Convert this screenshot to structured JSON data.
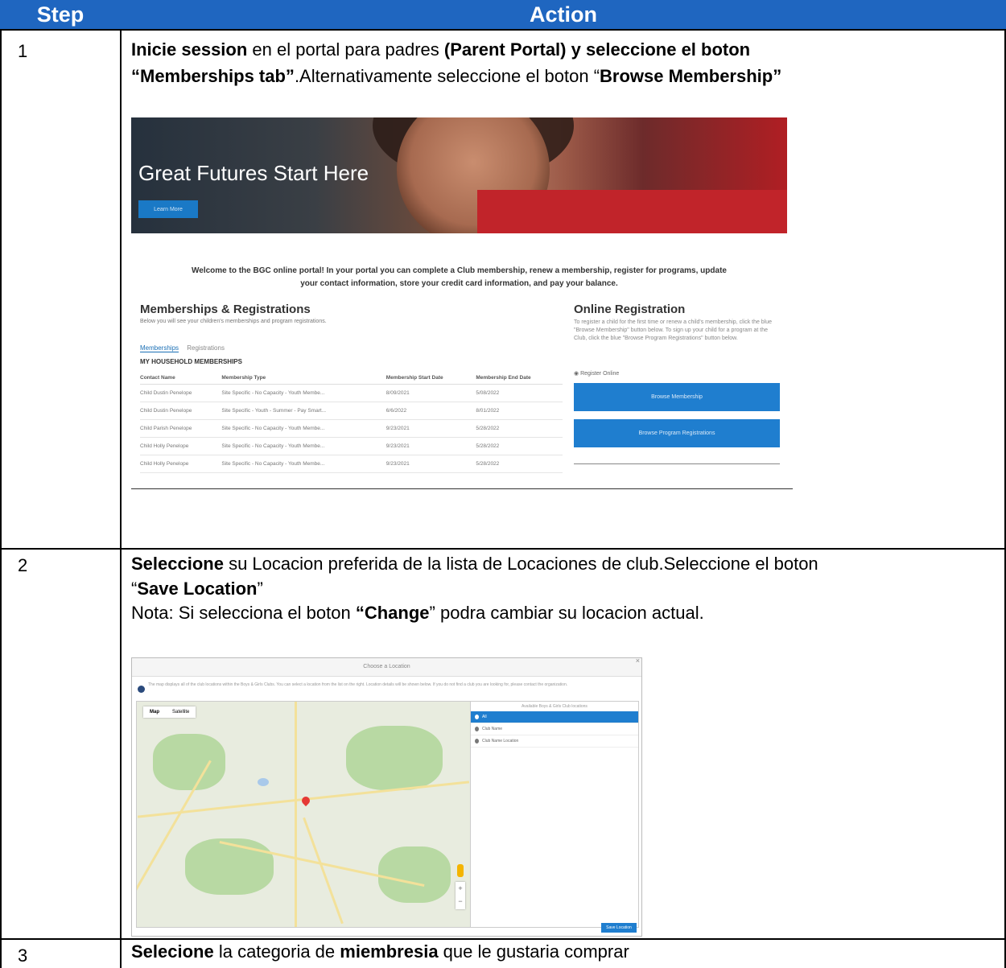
{
  "header": {
    "step_label": "Step",
    "action_label": "Action"
  },
  "colors": {
    "header_bg": "#1f66c0",
    "button_blue": "#1f7ecf"
  },
  "rows": [
    {
      "step": "1",
      "line1_bold": "Inicie session",
      "line1_mid": " en el portal para padres ",
      "line1_bold2": "(Parent Portal) y seleccione el boton",
      "line2_bold": "“Memberships tab”",
      "line2_mid": ".Alternativamente seleccione el boton “",
      "line2_bold2": "Browse  Membership”"
    },
    {
      "step": "2",
      "line1_bold": "Seleccione",
      "line1_mid": " su Locacion preferida de la lista de Locaciones de club.Seleccione el boton",
      "line2_pre": "“",
      "line2_bold": "Save Location",
      "line2_post": "”",
      "line3_pre": "Nota: Si selecciona el boton ",
      "line3_bold": "“Change",
      "line3_post": "” podra cambiar su locacion actual."
    },
    {
      "step": "3",
      "line1_bold": "Selecione",
      "line1_mid": " la categoria de ",
      "line1_bold2": "miembresia",
      "line1_post": " que le gustaria comprar"
    }
  ],
  "portal": {
    "hero_title": "Great Futures Start Here",
    "hero_button": "Learn More",
    "welcome_line1": "Welcome to the BGC online portal! In your portal you can complete a Club membership, renew a membership, register for programs, update",
    "welcome_line2": "your contact information, store your credit card information, and pay your balance.",
    "memberships_title": "Memberships & Registrations",
    "memberships_sub": "Below you will see your children's memberships and program registrations.",
    "tab_memberships": "Memberships",
    "tab_registrations": "Registrations",
    "household_title": "MY HOUSEHOLD MEMBERSHIPS",
    "table_headers": [
      "Contact Name",
      "Membership Type",
      "Membership Start Date",
      "Membership End Date"
    ],
    "table_rows": [
      [
        "Child Dustin Penelope",
        "Site Specific - No Capacity - Youth Membe...",
        "8/09/2021",
        "5/08/2022"
      ],
      [
        "Child Dustin Penelope",
        "Site Specific - Youth - Summer - Pay Smart...",
        "6/6/2022",
        "8/01/2022"
      ],
      [
        "Child Parish Penelope",
        "Site Specific - No Capacity - Youth Membe...",
        "9/23/2021",
        "5/28/2022"
      ],
      [
        "Child Holly Penelope",
        "Site Specific - No Capacity - Youth Membe...",
        "9/23/2021",
        "5/28/2022"
      ],
      [
        "Child Holly Penelope",
        "Site Specific - No Capacity - Youth Membe...",
        "9/23/2021",
        "5/28/2022"
      ]
    ],
    "online_title": "Online Registration",
    "online_sub": "To register a child for the first time or renew a child's membership, click the blue \"Browse Membership\" button below. To sign up your child for a program at the Club, click the blue \"Browse Program Registrations\" button below.",
    "register_online": "Register Online",
    "browse_membership_btn": "Browse Membership",
    "browse_program_btn": "Browse Program Registrations"
  },
  "location_dialog": {
    "title": "Choose a Location",
    "close": "×",
    "info": "The map displays all of the club locations within the Boys & Girls Clubs. You can select a location from the list on the right. Location details will be shown below. If you do not find a club you are looking for, please contact the organization.",
    "map_tab": "Map",
    "satellite_tab": "Satellite",
    "list_header": "Available Boys & Girls Club locations",
    "locations": [
      "All",
      "Club Name",
      "Club Name Location"
    ],
    "save_button": "Save Location",
    "zoom_in": "+",
    "zoom_out": "−",
    "map_icon": "map-pin-icon"
  }
}
